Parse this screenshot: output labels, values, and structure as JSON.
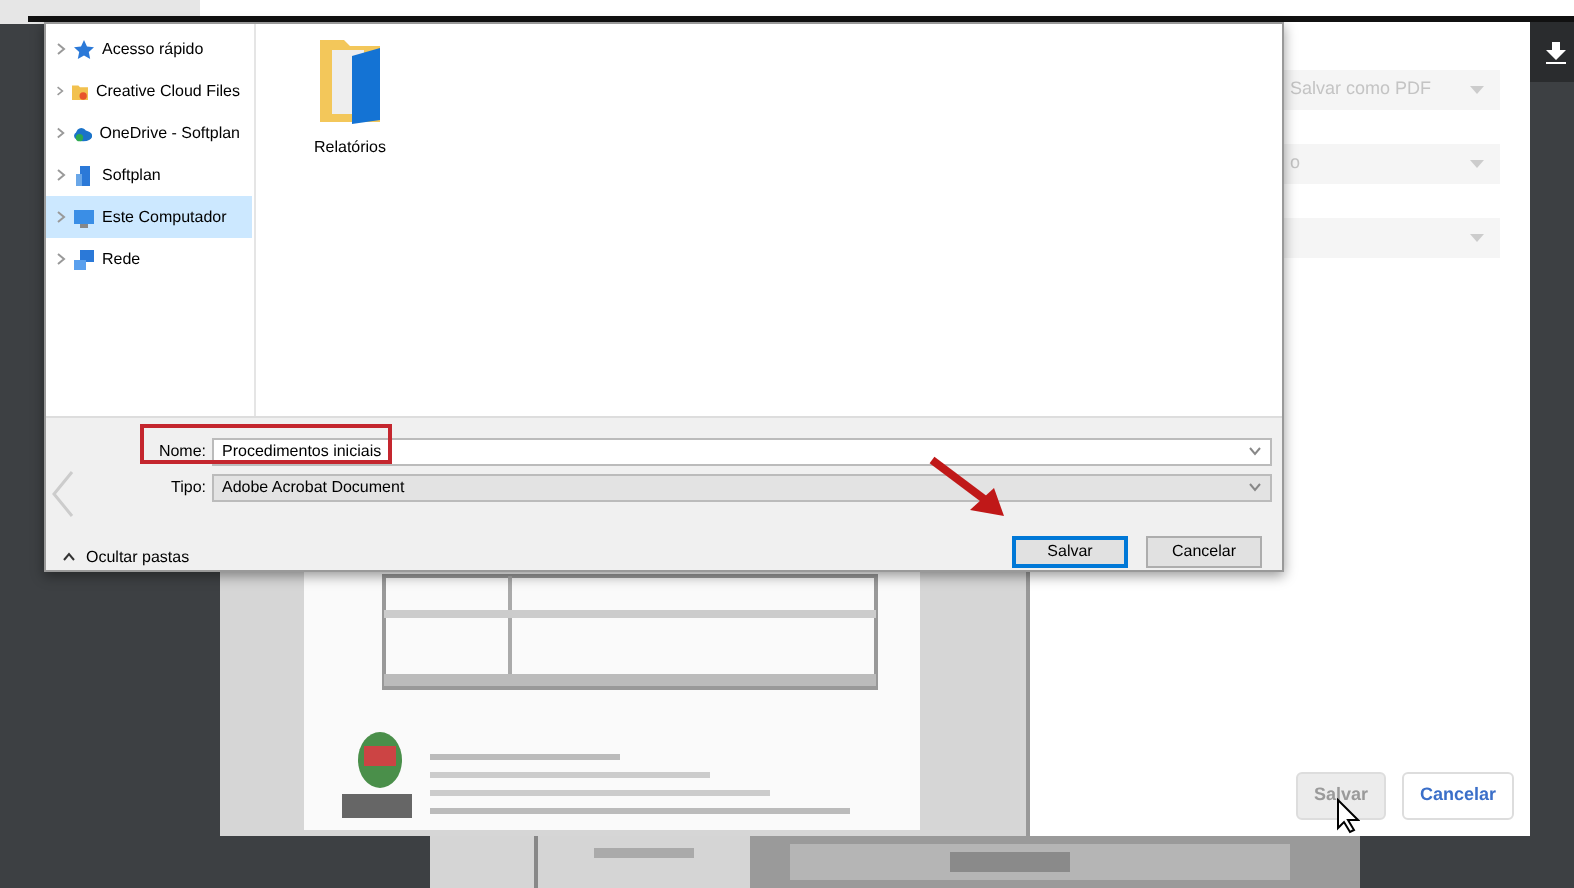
{
  "dialog": {
    "nav_items": [
      {
        "label": "Acesso rápido",
        "kind": "quick-access",
        "selected": false
      },
      {
        "label": "Creative Cloud Files",
        "kind": "cloud-files",
        "selected": false
      },
      {
        "label": "OneDrive - Softplan",
        "kind": "onedrive",
        "selected": false
      },
      {
        "label": "Softplan",
        "kind": "building",
        "selected": false
      },
      {
        "label": "Este Computador",
        "kind": "computer",
        "selected": true
      },
      {
        "label": "Rede",
        "kind": "network",
        "selected": false
      }
    ],
    "files": [
      {
        "name": "Relatórios"
      }
    ],
    "fields": [
      {
        "label": "Nome:",
        "value": "Procedimentos iniciais",
        "kind": "input",
        "highlighted": true
      },
      {
        "label": "Tipo:",
        "value": "Adobe Acrobat Document",
        "kind": "select",
        "highlighted": false
      }
    ],
    "toggle": "Ocultar pastas",
    "buttons": [
      {
        "label": "Salvar",
        "default": true
      },
      {
        "label": "Cancelar",
        "default": false
      }
    ]
  },
  "print_panel": {
    "settings": [
      {
        "value": "Salvar como PDF"
      },
      {
        "value": "o"
      },
      {
        "kind": "dropdown"
      }
    ],
    "buttons": [
      {
        "label": "Salvar",
        "disabled": true
      },
      {
        "label": "Cancelar",
        "disabled": false
      }
    ]
  }
}
